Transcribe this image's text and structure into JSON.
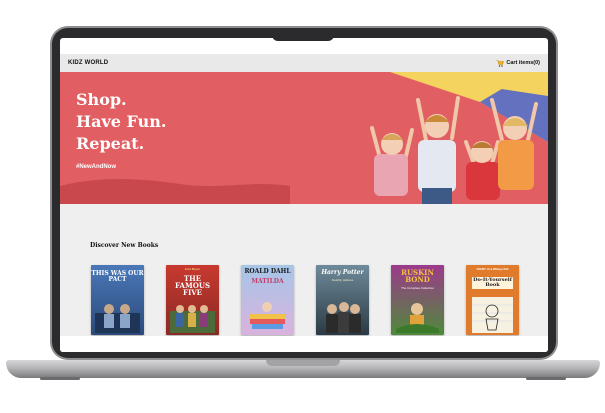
{
  "site": {
    "brand": "KIDZ WORLD",
    "cart_label": "Cart items(0)"
  },
  "hero": {
    "lines": [
      "Shop.",
      "Have Fun.",
      "Repeat."
    ],
    "hashtag": "#NewAndNow"
  },
  "section": {
    "title": "Discover New Books"
  },
  "books": [
    {
      "title": "THIS WAS OUR PACT",
      "author": ""
    },
    {
      "title": "THE FAMOUS FIVE",
      "author": "Enid Blyton"
    },
    {
      "title": "MATILDA",
      "author": "ROALD DAHL"
    },
    {
      "title": "Harry Potter",
      "author": "Deathly Hallows"
    },
    {
      "title": "RUSKIN BOND",
      "author": "The Complete Collection"
    },
    {
      "title": "Do-It-Yourself Book",
      "author": "DIARY of a Wimpy Kid"
    }
  ],
  "colors": {
    "hero_bg": "#e15f63",
    "hero_yellow": "#f4d35e",
    "hero_blue": "#5b6cc4",
    "hero_wave": "#c9484d"
  }
}
